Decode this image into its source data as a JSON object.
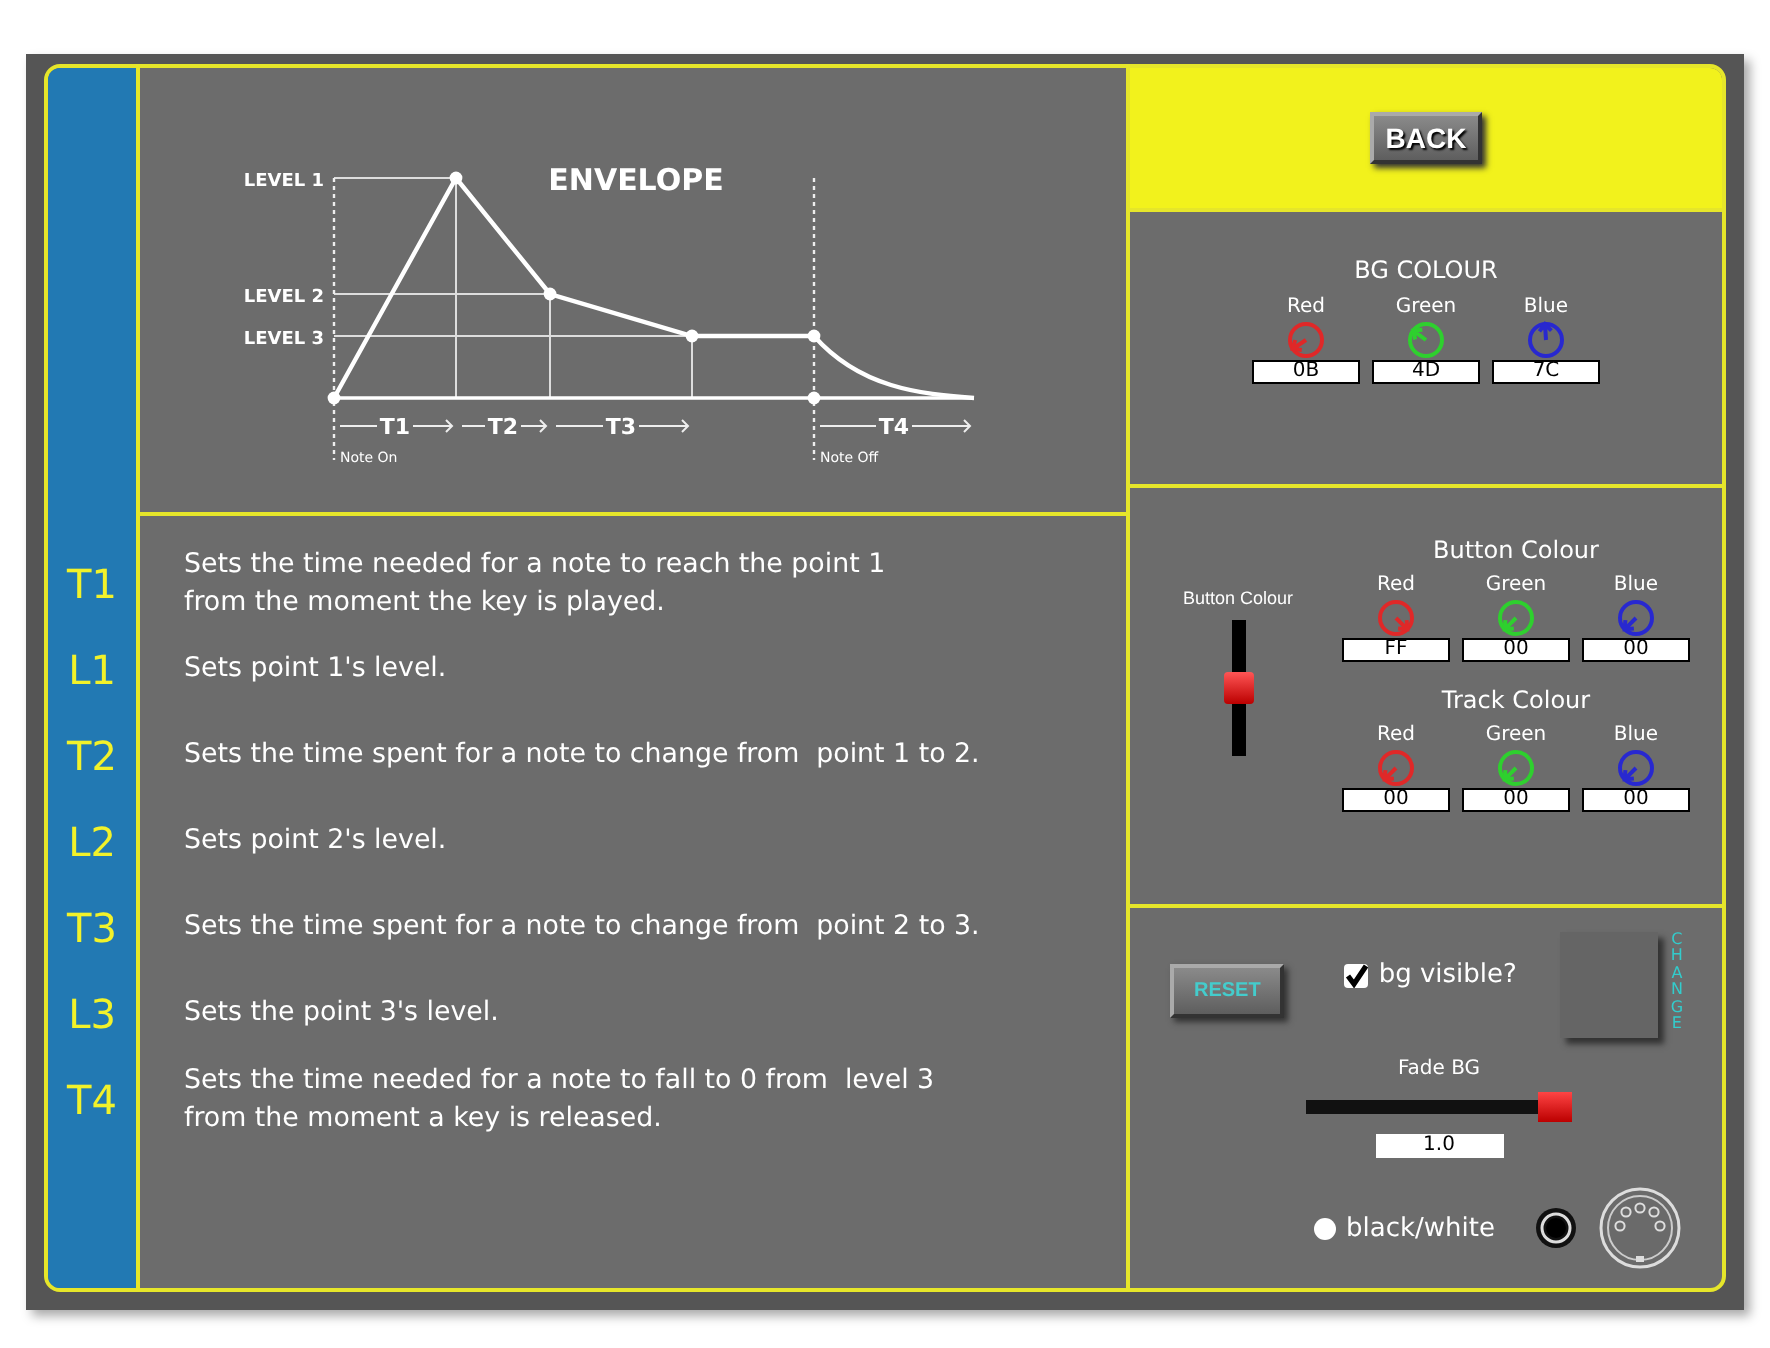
{
  "envelope": {
    "title": "ENVELOPE",
    "level_labels": [
      "LEVEL 1",
      "LEVEL 2",
      "LEVEL 3"
    ],
    "time_labels": [
      "T1",
      "T2",
      "T3",
      "T4"
    ],
    "markers": [
      "Note On",
      "Note Off"
    ]
  },
  "parameters": [
    {
      "label": "T1",
      "description": "Sets the time needed for a note to reach the point 1\nfrom the moment the key is played."
    },
    {
      "label": "L1",
      "description": "Sets point 1's level."
    },
    {
      "label": "T2",
      "description": "Sets the time spent for a note to change from  point 1 to 2."
    },
    {
      "label": "L2",
      "description": "Sets point 2's level."
    },
    {
      "label": "T3",
      "description": "Sets the time spent for a note to change from  point 2 to 3."
    },
    {
      "label": "L3",
      "description": "Sets the point 3's level."
    },
    {
      "label": "T4",
      "description": "Sets the time needed for a note to fall to 0 from  level 3\nfrom the moment a key is released."
    }
  ],
  "back_button": "BACK",
  "bg_colour": {
    "title": "BG COLOUR",
    "channels": [
      {
        "label": "Red",
        "value": "0B",
        "color": "#e02828"
      },
      {
        "label": "Green",
        "value": "4D",
        "color": "#2ed02e"
      },
      {
        "label": "Blue",
        "value": "7C",
        "color": "#2828d0"
      }
    ]
  },
  "button_slider": {
    "label": "Button Colour",
    "level": 0.5
  },
  "button_colour": {
    "title": "Button Colour",
    "channels": [
      {
        "label": "Red",
        "value": "FF",
        "color": "#e02828"
      },
      {
        "label": "Green",
        "value": "00",
        "color": "#2ed02e"
      },
      {
        "label": "Blue",
        "value": "00",
        "color": "#2828d0"
      }
    ]
  },
  "track_colour": {
    "title": "Track Colour",
    "channels": [
      {
        "label": "Red",
        "value": "00",
        "color": "#e02828"
      },
      {
        "label": "Green",
        "value": "00",
        "color": "#2ed02e"
      },
      {
        "label": "Blue",
        "value": "00",
        "color": "#2828d0"
      }
    ]
  },
  "reset_button": "RESET",
  "bg_visible": {
    "label": "bg visible?",
    "checked": true
  },
  "change_button": "CHANGE",
  "fade": {
    "label": "Fade BG",
    "level": 1,
    "value": "1.0"
  },
  "black_white": {
    "label": "black/white",
    "selected": false
  }
}
